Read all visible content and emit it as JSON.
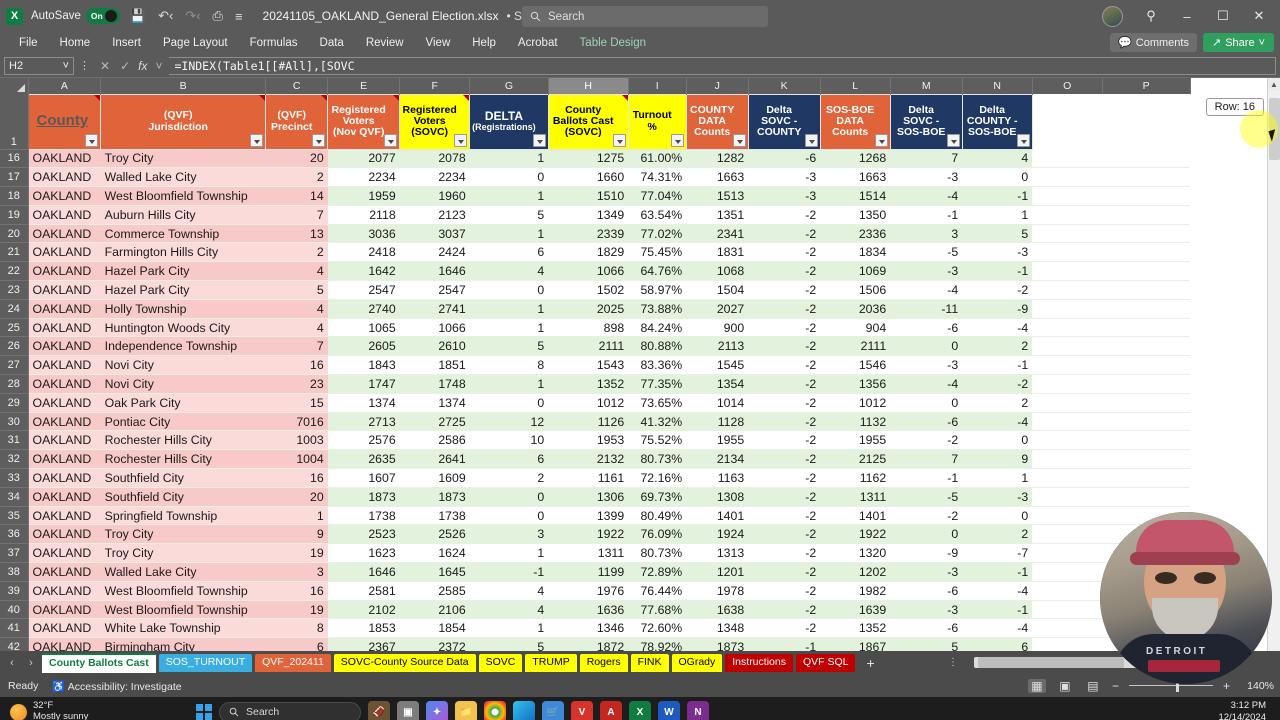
{
  "titlebar": {
    "excel_logo": "X",
    "autosave_label": "AutoSave",
    "autosave_state": "On",
    "document_name": "20241105_OAKLAND_General Election.xlsx",
    "saved_status": "• Saved",
    "search_placeholder": "Search",
    "icons": [
      "save-icon",
      "undo-icon",
      "redo-icon",
      "print-icon",
      "customize-icon"
    ],
    "window_buttons": [
      "minimize",
      "restore",
      "close"
    ]
  },
  "ribbon": {
    "tabs": [
      {
        "label": "File"
      },
      {
        "label": "Home"
      },
      {
        "label": "Insert"
      },
      {
        "label": "Page Layout"
      },
      {
        "label": "Formulas"
      },
      {
        "label": "Data"
      },
      {
        "label": "Review"
      },
      {
        "label": "View"
      },
      {
        "label": "Help"
      },
      {
        "label": "Acrobat"
      },
      {
        "label": "Table Design"
      }
    ],
    "comments_label": "Comments",
    "share_label": "Share"
  },
  "formula_bar": {
    "name_box": "H2",
    "formula": "=INDEX(Table1[[#All],[SOVC",
    "cancel": "✕",
    "enter": "✓",
    "fx": "fx"
  },
  "grid": {
    "column_letters": [
      "A",
      "B",
      "C",
      "E",
      "F",
      "G",
      "H",
      "I",
      "J",
      "K",
      "L",
      "M",
      "N",
      "O",
      "P"
    ],
    "active_column": "H",
    "row_tooltip": "Row: 16",
    "headers": [
      {
        "col": "A",
        "text": "County",
        "style": "orange",
        "align": "left",
        "underline": true,
        "comment": true,
        "filter": true
      },
      {
        "col": "B",
        "lines": [
          "(QVF)",
          "Jurisdiction"
        ],
        "style": "orange",
        "comment": true,
        "filter": true
      },
      {
        "col": "C",
        "lines": [
          "(QVF)",
          "Precinct"
        ],
        "style": "orange",
        "comment": true,
        "filter": true
      },
      {
        "col": "E",
        "lines": [
          "Registered",
          "Voters",
          "(Nov QVF)"
        ],
        "style": "orange",
        "comment": true,
        "filter": true
      },
      {
        "col": "F",
        "lines": [
          "Registered",
          "Voters",
          "(SOVC)"
        ],
        "style": "yellow",
        "comment": true,
        "filter": true
      },
      {
        "col": "G",
        "lines": [
          "DELTA",
          "(Registrations)"
        ],
        "style": "navy",
        "comment": false,
        "filter": true
      },
      {
        "col": "H",
        "lines": [
          "County",
          "Ballots Cast",
          "(SOVC)"
        ],
        "style": "yellow",
        "comment": true,
        "filter": true
      },
      {
        "col": "I",
        "lines": [
          "Turnout",
          "%"
        ],
        "style": "yellow",
        "comment": false,
        "filter": true
      },
      {
        "col": "J",
        "lines": [
          "COUNTY",
          "DATA",
          "Counts"
        ],
        "style": "orange",
        "comment": false,
        "filter": true
      },
      {
        "col": "K",
        "lines": [
          "Delta",
          "SOVC -",
          "COUNTY"
        ],
        "style": "navy",
        "comment": false,
        "filter": true
      },
      {
        "col": "L",
        "lines": [
          "SOS-BOE",
          "DATA",
          "Counts"
        ],
        "style": "orange",
        "comment": false,
        "filter": true
      },
      {
        "col": "M",
        "lines": [
          "Delta",
          "SOVC -",
          "SOS-BOE"
        ],
        "style": "navy",
        "comment": false,
        "filter": true
      },
      {
        "col": "N",
        "lines": [
          "Delta",
          "COUNTY -",
          "SOS-BOE"
        ],
        "style": "navy",
        "comment": false,
        "filter": true
      }
    ],
    "rows": [
      {
        "n": "16",
        "county": "OAKLAND",
        "jurisdiction": "Troy City",
        "precinct": "20",
        "reg_qvf": "2077",
        "reg_sovc": "2078",
        "delta_reg": "1",
        "ballots": "1275",
        "turnout": "61.00%",
        "county_counts": "1282",
        "delta_sovc_county": "-6",
        "sos_counts": "1268",
        "delta_sovc_sos": "7",
        "delta_county_sos": "4",
        "band": "green",
        "clipped": true
      },
      {
        "n": "17",
        "county": "OAKLAND",
        "jurisdiction": "Walled Lake City",
        "precinct": "2",
        "reg_qvf": "2234",
        "reg_sovc": "2234",
        "delta_reg": "0",
        "ballots": "1660",
        "turnout": "74.31%",
        "county_counts": "1663",
        "delta_sovc_county": "-3",
        "sos_counts": "1663",
        "delta_sovc_sos": "-3",
        "delta_county_sos": "0",
        "band": "white"
      },
      {
        "n": "18",
        "county": "OAKLAND",
        "jurisdiction": "West Bloomfield Township",
        "precinct": "14",
        "reg_qvf": "1959",
        "reg_sovc": "1960",
        "delta_reg": "1",
        "ballots": "1510",
        "turnout": "77.04%",
        "county_counts": "1513",
        "delta_sovc_county": "-3",
        "sos_counts": "1514",
        "delta_sovc_sos": "-4",
        "delta_county_sos": "-1",
        "band": "green"
      },
      {
        "n": "19",
        "county": "OAKLAND",
        "jurisdiction": "Auburn Hills City",
        "precinct": "7",
        "reg_qvf": "2118",
        "reg_sovc": "2123",
        "delta_reg": "5",
        "ballots": "1349",
        "turnout": "63.54%",
        "county_counts": "1351",
        "delta_sovc_county": "-2",
        "sos_counts": "1350",
        "delta_sovc_sos": "-1",
        "delta_county_sos": "1",
        "band": "white"
      },
      {
        "n": "20",
        "county": "OAKLAND",
        "jurisdiction": "Commerce Township",
        "precinct": "13",
        "reg_qvf": "3036",
        "reg_sovc": "3037",
        "delta_reg": "1",
        "ballots": "2339",
        "turnout": "77.02%",
        "county_counts": "2341",
        "delta_sovc_county": "-2",
        "sos_counts": "2336",
        "delta_sovc_sos": "3",
        "delta_county_sos": "5",
        "band": "green"
      },
      {
        "n": "21",
        "county": "OAKLAND",
        "jurisdiction": "Farmington Hills City",
        "precinct": "2",
        "reg_qvf": "2418",
        "reg_sovc": "2424",
        "delta_reg": "6",
        "ballots": "1829",
        "turnout": "75.45%",
        "county_counts": "1831",
        "delta_sovc_county": "-2",
        "sos_counts": "1834",
        "delta_sovc_sos": "-5",
        "delta_county_sos": "-3",
        "band": "white"
      },
      {
        "n": "22",
        "county": "OAKLAND",
        "jurisdiction": "Hazel Park City",
        "precinct": "4",
        "reg_qvf": "1642",
        "reg_sovc": "1646",
        "delta_reg": "4",
        "ballots": "1066",
        "turnout": "64.76%",
        "county_counts": "1068",
        "delta_sovc_county": "-2",
        "sos_counts": "1069",
        "delta_sovc_sos": "-3",
        "delta_county_sos": "-1",
        "band": "green"
      },
      {
        "n": "23",
        "county": "OAKLAND",
        "jurisdiction": "Hazel Park City",
        "precinct": "5",
        "reg_qvf": "2547",
        "reg_sovc": "2547",
        "delta_reg": "0",
        "ballots": "1502",
        "turnout": "58.97%",
        "county_counts": "1504",
        "delta_sovc_county": "-2",
        "sos_counts": "1506",
        "delta_sovc_sos": "-4",
        "delta_county_sos": "-2",
        "band": "white"
      },
      {
        "n": "24",
        "county": "OAKLAND",
        "jurisdiction": "Holly Township",
        "precinct": "4",
        "reg_qvf": "2740",
        "reg_sovc": "2741",
        "delta_reg": "1",
        "ballots": "2025",
        "turnout": "73.88%",
        "county_counts": "2027",
        "delta_sovc_county": "-2",
        "sos_counts": "2036",
        "delta_sovc_sos": "-11",
        "delta_county_sos": "-9",
        "band": "green"
      },
      {
        "n": "25",
        "county": "OAKLAND",
        "jurisdiction": "Huntington Woods City",
        "precinct": "4",
        "reg_qvf": "1065",
        "reg_sovc": "1066",
        "delta_reg": "1",
        "ballots": "898",
        "turnout": "84.24%",
        "county_counts": "900",
        "delta_sovc_county": "-2",
        "sos_counts": "904",
        "delta_sovc_sos": "-6",
        "delta_county_sos": "-4",
        "band": "white"
      },
      {
        "n": "26",
        "county": "OAKLAND",
        "jurisdiction": "Independence Township",
        "precinct": "7",
        "reg_qvf": "2605",
        "reg_sovc": "2610",
        "delta_reg": "5",
        "ballots": "2111",
        "turnout": "80.88%",
        "county_counts": "2113",
        "delta_sovc_county": "-2",
        "sos_counts": "2111",
        "delta_sovc_sos": "0",
        "delta_county_sos": "2",
        "band": "green"
      },
      {
        "n": "27",
        "county": "OAKLAND",
        "jurisdiction": "Novi City",
        "precinct": "16",
        "reg_qvf": "1843",
        "reg_sovc": "1851",
        "delta_reg": "8",
        "ballots": "1543",
        "turnout": "83.36%",
        "county_counts": "1545",
        "delta_sovc_county": "-2",
        "sos_counts": "1546",
        "delta_sovc_sos": "-3",
        "delta_county_sos": "-1",
        "band": "white"
      },
      {
        "n": "28",
        "county": "OAKLAND",
        "jurisdiction": "Novi City",
        "precinct": "23",
        "reg_qvf": "1747",
        "reg_sovc": "1748",
        "delta_reg": "1",
        "ballots": "1352",
        "turnout": "77.35%",
        "county_counts": "1354",
        "delta_sovc_county": "-2",
        "sos_counts": "1356",
        "delta_sovc_sos": "-4",
        "delta_county_sos": "-2",
        "band": "green"
      },
      {
        "n": "29",
        "county": "OAKLAND",
        "jurisdiction": "Oak Park City",
        "precinct": "15",
        "reg_qvf": "1374",
        "reg_sovc": "1374",
        "delta_reg": "0",
        "ballots": "1012",
        "turnout": "73.65%",
        "county_counts": "1014",
        "delta_sovc_county": "-2",
        "sos_counts": "1012",
        "delta_sovc_sos": "0",
        "delta_county_sos": "2",
        "band": "white"
      },
      {
        "n": "30",
        "county": "OAKLAND",
        "jurisdiction": "Pontiac City",
        "precinct": "7016",
        "reg_qvf": "2713",
        "reg_sovc": "2725",
        "delta_reg": "12",
        "ballots": "1126",
        "turnout": "41.32%",
        "county_counts": "1128",
        "delta_sovc_county": "-2",
        "sos_counts": "1132",
        "delta_sovc_sos": "-6",
        "delta_county_sos": "-4",
        "band": "green"
      },
      {
        "n": "31",
        "county": "OAKLAND",
        "jurisdiction": "Rochester Hills City",
        "precinct": "1003",
        "reg_qvf": "2576",
        "reg_sovc": "2586",
        "delta_reg": "10",
        "ballots": "1953",
        "turnout": "75.52%",
        "county_counts": "1955",
        "delta_sovc_county": "-2",
        "sos_counts": "1955",
        "delta_sovc_sos": "-2",
        "delta_county_sos": "0",
        "band": "white"
      },
      {
        "n": "32",
        "county": "OAKLAND",
        "jurisdiction": "Rochester Hills City",
        "precinct": "1004",
        "reg_qvf": "2635",
        "reg_sovc": "2641",
        "delta_reg": "6",
        "ballots": "2132",
        "turnout": "80.73%",
        "county_counts": "2134",
        "delta_sovc_county": "-2",
        "sos_counts": "2125",
        "delta_sovc_sos": "7",
        "delta_county_sos": "9",
        "band": "green"
      },
      {
        "n": "33",
        "county": "OAKLAND",
        "jurisdiction": "Southfield City",
        "precinct": "16",
        "reg_qvf": "1607",
        "reg_sovc": "1609",
        "delta_reg": "2",
        "ballots": "1161",
        "turnout": "72.16%",
        "county_counts": "1163",
        "delta_sovc_county": "-2",
        "sos_counts": "1162",
        "delta_sovc_sos": "-1",
        "delta_county_sos": "1",
        "band": "white"
      },
      {
        "n": "34",
        "county": "OAKLAND",
        "jurisdiction": "Southfield City",
        "precinct": "20",
        "reg_qvf": "1873",
        "reg_sovc": "1873",
        "delta_reg": "0",
        "ballots": "1306",
        "turnout": "69.73%",
        "county_counts": "1308",
        "delta_sovc_county": "-2",
        "sos_counts": "1311",
        "delta_sovc_sos": "-5",
        "delta_county_sos": "-3",
        "band": "green"
      },
      {
        "n": "35",
        "county": "OAKLAND",
        "jurisdiction": "Springfield Township",
        "precinct": "1",
        "reg_qvf": "1738",
        "reg_sovc": "1738",
        "delta_reg": "0",
        "ballots": "1399",
        "turnout": "80.49%",
        "county_counts": "1401",
        "delta_sovc_county": "-2",
        "sos_counts": "1401",
        "delta_sovc_sos": "-2",
        "delta_county_sos": "0",
        "band": "white"
      },
      {
        "n": "36",
        "county": "OAKLAND",
        "jurisdiction": "Troy City",
        "precinct": "9",
        "reg_qvf": "2523",
        "reg_sovc": "2526",
        "delta_reg": "3",
        "ballots": "1922",
        "turnout": "76.09%",
        "county_counts": "1924",
        "delta_sovc_county": "-2",
        "sos_counts": "1922",
        "delta_sovc_sos": "0",
        "delta_county_sos": "2",
        "band": "green"
      },
      {
        "n": "37",
        "county": "OAKLAND",
        "jurisdiction": "Troy City",
        "precinct": "19",
        "reg_qvf": "1623",
        "reg_sovc": "1624",
        "delta_reg": "1",
        "ballots": "1311",
        "turnout": "80.73%",
        "county_counts": "1313",
        "delta_sovc_county": "-2",
        "sos_counts": "1320",
        "delta_sovc_sos": "-9",
        "delta_county_sos": "-7",
        "band": "white"
      },
      {
        "n": "38",
        "county": "OAKLAND",
        "jurisdiction": "Walled Lake City",
        "precinct": "3",
        "reg_qvf": "1646",
        "reg_sovc": "1645",
        "delta_reg": "-1",
        "ballots": "1199",
        "turnout": "72.89%",
        "county_counts": "1201",
        "delta_sovc_county": "-2",
        "sos_counts": "1202",
        "delta_sovc_sos": "-3",
        "delta_county_sos": "-1",
        "band": "green"
      },
      {
        "n": "39",
        "county": "OAKLAND",
        "jurisdiction": "West Bloomfield Township",
        "precinct": "16",
        "reg_qvf": "2581",
        "reg_sovc": "2585",
        "delta_reg": "4",
        "ballots": "1976",
        "turnout": "76.44%",
        "county_counts": "1978",
        "delta_sovc_county": "-2",
        "sos_counts": "1982",
        "delta_sovc_sos": "-6",
        "delta_county_sos": "-4",
        "band": "white"
      },
      {
        "n": "40",
        "county": "OAKLAND",
        "jurisdiction": "West Bloomfield Township",
        "precinct": "19",
        "reg_qvf": "2102",
        "reg_sovc": "2106",
        "delta_reg": "4",
        "ballots": "1636",
        "turnout": "77.68%",
        "county_counts": "1638",
        "delta_sovc_county": "-2",
        "sos_counts": "1639",
        "delta_sovc_sos": "-3",
        "delta_county_sos": "-1",
        "band": "green"
      },
      {
        "n": "41",
        "county": "OAKLAND",
        "jurisdiction": "White Lake Township",
        "precinct": "8",
        "reg_qvf": "1853",
        "reg_sovc": "1854",
        "delta_reg": "1",
        "ballots": "1346",
        "turnout": "72.60%",
        "county_counts": "1348",
        "delta_sovc_county": "-2",
        "sos_counts": "1352",
        "delta_sovc_sos": "-6",
        "delta_county_sos": "-4",
        "band": "white"
      },
      {
        "n": "42",
        "county": "OAKLAND",
        "jurisdiction": "Birmingham City",
        "precinct": "6",
        "reg_qvf": "2367",
        "reg_sovc": "2372",
        "delta_reg": "5",
        "ballots": "1872",
        "turnout": "78.92%",
        "county_counts": "1873",
        "delta_sovc_county": "-1",
        "sos_counts": "1867",
        "delta_sovc_sos": "5",
        "delta_county_sos": "6",
        "band": "green"
      }
    ]
  },
  "sheet_tabs": {
    "nav_prev": "‹",
    "nav_next": "›",
    "add_label": "+",
    "tabs": [
      {
        "label": "County Ballots Cast",
        "color": "#ffffff",
        "text_color": "#107c41",
        "active": true
      },
      {
        "label": "SOS_TURNOUT",
        "color": "#3aaee0",
        "text_color": "#ffffff"
      },
      {
        "label": "QVF_202411",
        "color": "#e0633a",
        "text_color": "#ffffff"
      },
      {
        "label": "SOVC-County Source Data",
        "color": "#ffff00",
        "text_color": "#000000"
      },
      {
        "label": "SOVC",
        "color": "#ffff00",
        "text_color": "#000000"
      },
      {
        "label": "TRUMP",
        "color": "#ffff00",
        "text_color": "#000000"
      },
      {
        "label": "Rogers",
        "color": "#ffff00",
        "text_color": "#000000"
      },
      {
        "label": "FINK",
        "color": "#ffff00",
        "text_color": "#000000"
      },
      {
        "label": "OGrady",
        "color": "#ffff00",
        "text_color": "#000000"
      },
      {
        "label": "Instructions",
        "color": "#c00000",
        "text_color": "#ffffff"
      },
      {
        "label": "QVF SQL",
        "color": "#c00000",
        "text_color": "#ffffff"
      }
    ]
  },
  "status_bar": {
    "ready": "Ready",
    "accessibility": "Accessibility: Investigate",
    "view_buttons": [
      "normal-view",
      "page-layout-view",
      "page-break-view"
    ],
    "zoom_minus": "−",
    "zoom_plus": "+",
    "zoom_level": "140%"
  },
  "taskbar": {
    "weather_temp": "32°F",
    "weather_desc": "Mostly sunny",
    "search_placeholder": "Search",
    "apps": [
      "task-view",
      "copilot",
      "file-explorer",
      "chrome",
      "edge",
      "store",
      "vivaldi",
      "acrobat",
      "excel",
      "word",
      "onenote"
    ],
    "time": "3:12 PM",
    "date": "12/14/2024"
  }
}
